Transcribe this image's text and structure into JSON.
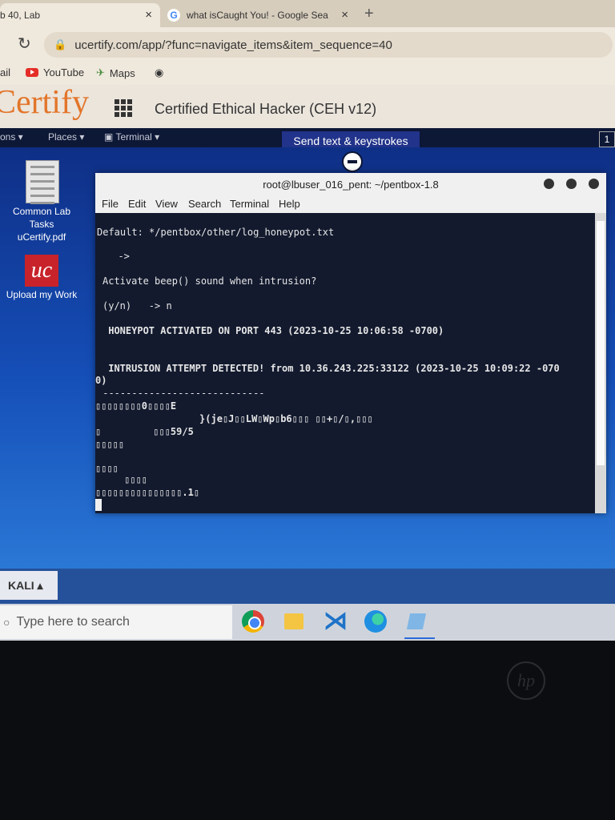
{
  "browser": {
    "tabs": [
      {
        "title": "b 40, Lab"
      },
      {
        "title": "what isCaught You! - Google Sea"
      }
    ],
    "new_tab": "+",
    "close_glyph": "×",
    "url": "ucertify.com/app/?func=navigate_items&item_sequence=40",
    "bookmarks": [
      {
        "label": "ail"
      },
      {
        "label": "YouTube"
      },
      {
        "label": "Maps"
      }
    ]
  },
  "ucertify": {
    "logo": "Certify",
    "course": "Certified Ethical Hacker (CEH v12)"
  },
  "vm": {
    "menu": [
      "ons ▾",
      "Places ▾",
      "Terminal ▾"
    ],
    "send_text": "Send text & keystrokes",
    "number": "1"
  },
  "desktop": {
    "icons": [
      {
        "label": "Common Lab Tasks uCertify.pdf"
      },
      {
        "label": "Upload my Work"
      }
    ]
  },
  "terminal": {
    "title": "root@lbuser_016_pent: ~/pentbox-1.8",
    "menu": [
      "File",
      "Edit",
      "View",
      "Search",
      "Terminal",
      "Help"
    ],
    "lines": [
      "Default: */pentbox/other/log_honeypot.txt",
      "  ->",
      "Activate beep() sound when intrusion?",
      "(y/n)   -> n",
      " HONEYPOT ACTIVATED ON PORT 443 (2023-10-25 10:06:58 -0700)",
      " INTRUSION ATTEMPT DETECTED! from 10.36.243.225:33122 (2023-10-25 10:09:22 -070",
      "0)",
      " ----------------------------",
      "▯▯▯▯▯▯▯▯0▯▯▯▯E",
      "                  }(je▯J▯▯LW▯Wp▯b6▯▯▯ ▯▯+▯/▯,▯▯▯",
      "▯         ▯▯▯59/5",
      "▯▯▯▯▯",
      "▯▯▯▯",
      "     ▯▯▯▯",
      "▯▯▯▯▯▯▯▯▯▯▯▯▯▯▯.1▯"
    ]
  },
  "taskbar": {
    "kali_label": "KALI ▴",
    "search_placeholder": "Type here to search"
  },
  "laptop": {
    "brand": "hp"
  }
}
